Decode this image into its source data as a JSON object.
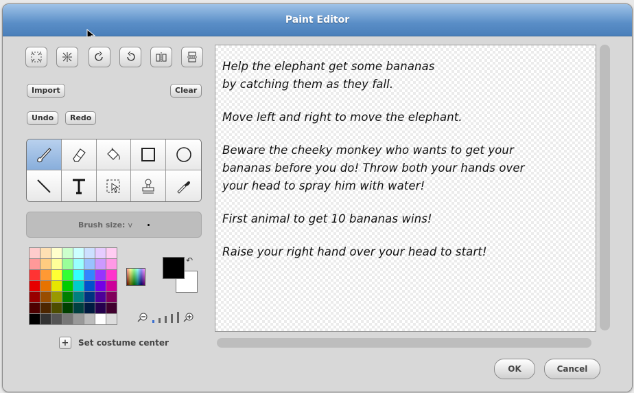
{
  "window": {
    "title": "Paint Editor"
  },
  "toolbar_top": [
    "grow-icon",
    "shrink-icon",
    "rotate-left-icon",
    "rotate-right-icon",
    "flip-horizontal-icon",
    "flip-vertical-icon"
  ],
  "buttons": {
    "import": "Import",
    "clear": "Clear",
    "undo": "Undo",
    "redo": "Redo",
    "ok": "OK",
    "cancel": "Cancel"
  },
  "tools": [
    "paintbrush-icon",
    "eraser-icon",
    "fill-bucket-icon",
    "rectangle-icon",
    "ellipse-icon",
    "line-icon",
    "text-icon",
    "select-icon",
    "stamp-icon",
    "eyedropper-icon"
  ],
  "active_tool": "paintbrush-icon",
  "brush": {
    "label": "Brush size:",
    "chevron": "v"
  },
  "palette": [
    "#ffcccc",
    "#ffe0b3",
    "#ffffcc",
    "#ccffcc",
    "#ccffff",
    "#cce0ff",
    "#e6ccff",
    "#ffccf2",
    "#ff9999",
    "#ffcc80",
    "#ffff99",
    "#99ff99",
    "#99ffff",
    "#99c2ff",
    "#cc99ff",
    "#ff99e6",
    "#ff3333",
    "#ff9933",
    "#ffff33",
    "#33ff33",
    "#33ffff",
    "#3385ff",
    "#9933ff",
    "#ff33cc",
    "#e60000",
    "#e67300",
    "#e6e600",
    "#00cc00",
    "#00cccc",
    "#0052cc",
    "#7300e6",
    "#cc0099",
    "#990000",
    "#994d00",
    "#999900",
    "#008000",
    "#008080",
    "#003380",
    "#4d0099",
    "#80005c",
    "#4d0000",
    "#4d2600",
    "#4d4d00",
    "#004000",
    "#004040",
    "#001a40",
    "#26004d",
    "#40002e",
    "#000000",
    "#333333",
    "#555555",
    "#777777",
    "#999999",
    "#bbbbbb",
    "#ffffff",
    "#dddddd"
  ],
  "colors": {
    "foreground": "#000000",
    "background": "#ffffff",
    "title_bar": "#5a8ec7"
  },
  "zoom": {
    "out_icon": "zoom-out-icon",
    "in_icon": "zoom-in-icon",
    "level": 1
  },
  "costume_center": {
    "label": "Set costume center"
  },
  "canvas_text": [
    "Help the elephant get some bananas",
    "by catching them as they fall.",
    "",
    "Move left and right to move the elephant.",
    "",
    "Beware the cheeky monkey who wants to get your",
    "bananas before you do! Throw both your hands over",
    "your head to spray him with water!",
    "",
    "First animal to get 10 bananas wins!",
    "",
    "Raise your right hand over your head to start!"
  ]
}
